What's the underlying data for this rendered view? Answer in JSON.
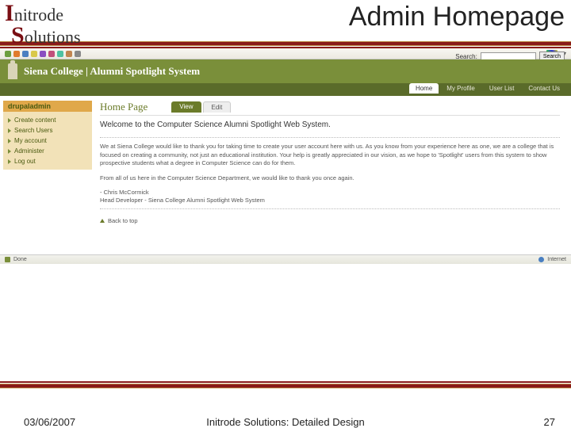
{
  "slide": {
    "logo_line1_cap": "I",
    "logo_line1_rest": "nitrode",
    "logo_line2_cap": "S",
    "logo_line2_rest": "olutions",
    "title": "Admin Homepage",
    "date": "03/06/2007",
    "footer_center": "Initrode Solutions: Detailed Design",
    "page_number": "27"
  },
  "search": {
    "label": "Search:",
    "placeholder": "",
    "button": "Search"
  },
  "site": {
    "title": "Siena College | Alumni Spotlight System"
  },
  "nav": {
    "tabs": [
      {
        "label": "Home",
        "active": true
      },
      {
        "label": "My Profile",
        "active": false
      },
      {
        "label": "User List",
        "active": false
      },
      {
        "label": "Contact Us",
        "active": false
      }
    ]
  },
  "sidebar": {
    "title": "drupaladmin",
    "items": [
      {
        "label": "Create content"
      },
      {
        "label": "Search Users"
      },
      {
        "label": "My account"
      },
      {
        "label": "Administer"
      },
      {
        "label": "Log out"
      }
    ]
  },
  "page": {
    "title": "Home Page",
    "tab_view": "View",
    "tab_edit": "Edit",
    "welcome": "Welcome to the Computer Science Alumni Spotlight Web System.",
    "para1": "We at Siena College would like to thank you for taking time to create your user account here with us. As you know from your experience here as one, we are a college that is focused on creating a community, not just an educational institution. Your help is greatly appreciated in our vision, as we hope to 'Spotlight' users from this system to show prospective students what a degree in Computer Science can do for them.",
    "para2": "From all of us here in the Computer Science Department, we would like to thank you once again.",
    "sign_name": "- Chris McCormick",
    "sign_title": "Head Developer - Siena College Alumni Spotlight Web System",
    "back_top": "Back to top"
  },
  "status": {
    "left": "Done",
    "right": "Internet"
  }
}
